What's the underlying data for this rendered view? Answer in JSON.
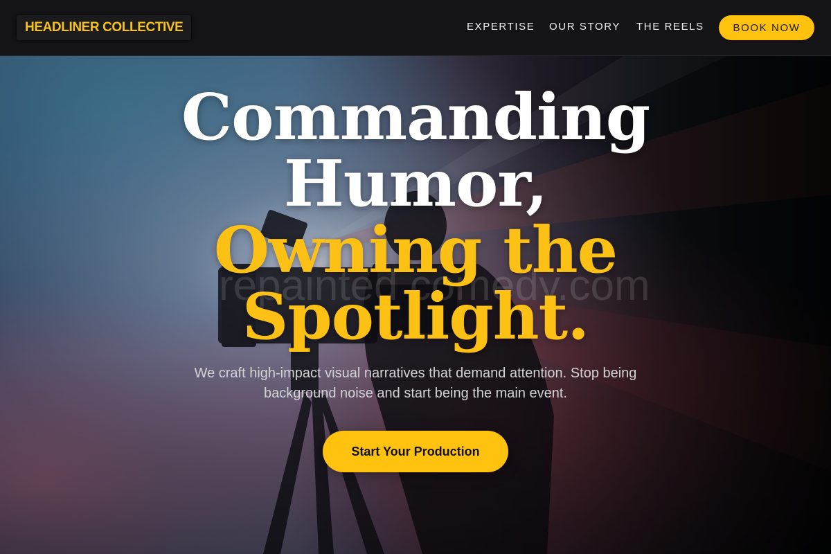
{
  "brand": {
    "name": "HEADLINER COLLECTIVE"
  },
  "nav": {
    "links": [
      "EXPERTISE",
      "OUR STORY",
      "THE REELS"
    ],
    "cta_label": "BOOK NOW"
  },
  "hero": {
    "headline_white_1": "Commanding",
    "headline_white_2": "Humor,",
    "headline_gold_1": "Owning the",
    "headline_gold_2": "Spotlight.",
    "subtitle": "We craft high-impact visual narratives that demand attention. Stop being background noise and start being the main event.",
    "cta_label": "Start Your Production",
    "watermark": "repainted comedy.com",
    "background_image": "camera-on-tripod-in-stage-light"
  },
  "colors": {
    "accent": "#fec20f",
    "navbar_bg": "#141416",
    "text_light": "#ffffff"
  }
}
